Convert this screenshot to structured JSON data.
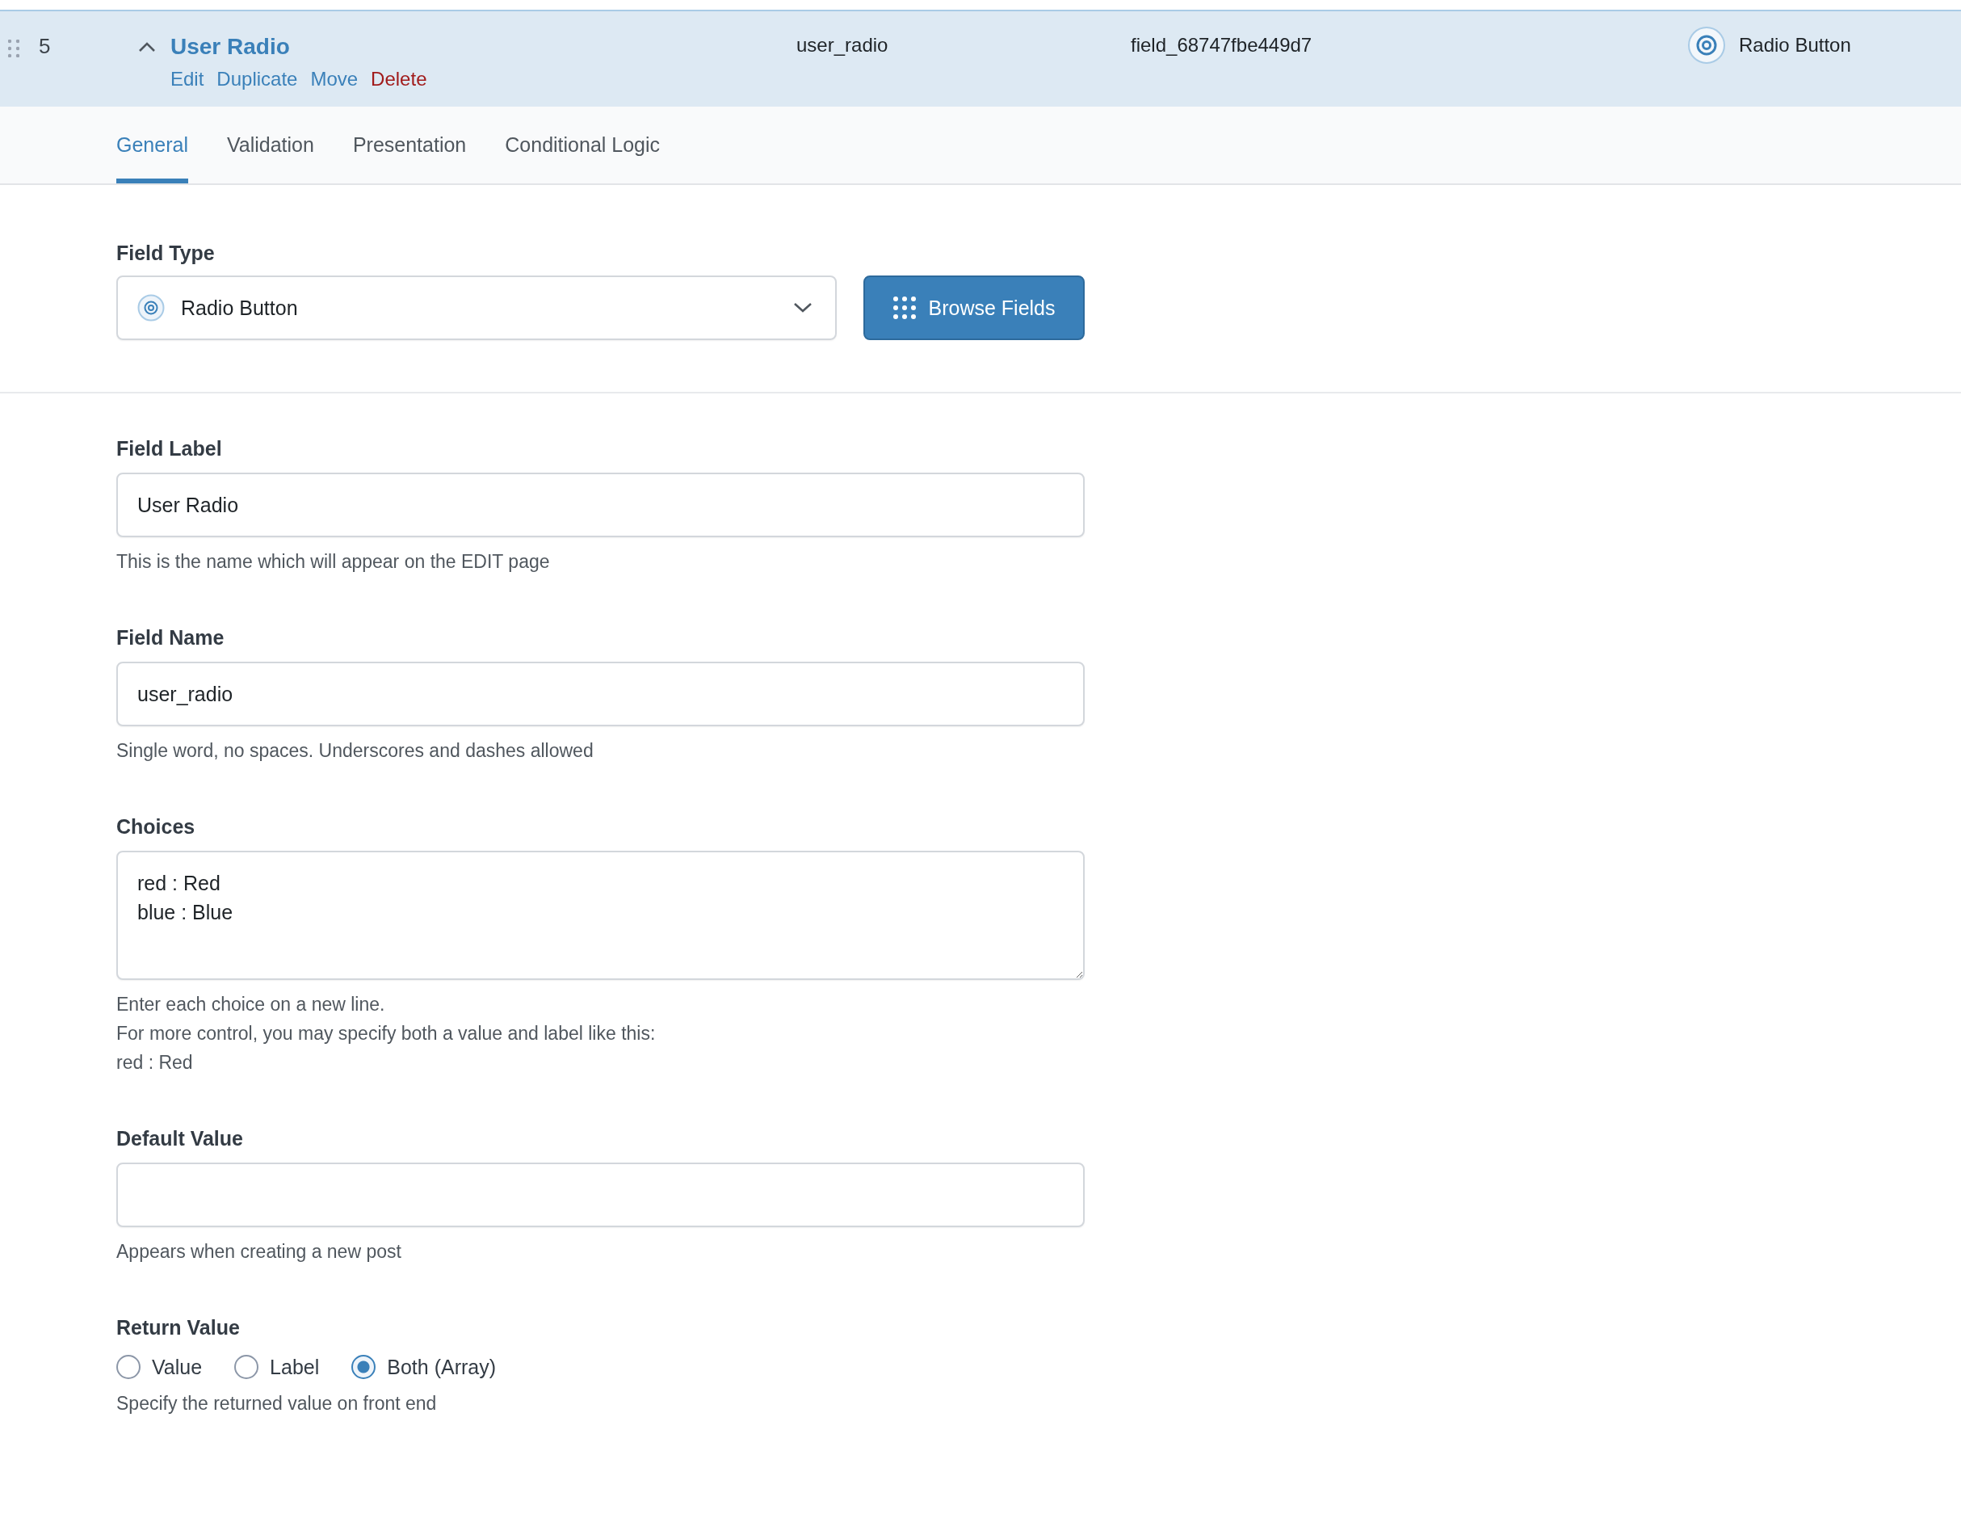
{
  "field_row": {
    "order": "5",
    "expanded": true,
    "label": "User Radio",
    "name": "user_radio",
    "key": "field_68747fbe449d7",
    "type": "Radio Button",
    "actions": [
      {
        "label": "Edit",
        "kind": "link"
      },
      {
        "label": "Duplicate",
        "kind": "link"
      },
      {
        "label": "Move",
        "kind": "link"
      },
      {
        "label": "Delete",
        "kind": "danger"
      }
    ]
  },
  "tabs": [
    {
      "label": "General",
      "selected": true
    },
    {
      "label": "Validation",
      "selected": false
    },
    {
      "label": "Presentation",
      "selected": false
    },
    {
      "label": "Conditional Logic",
      "selected": false
    }
  ],
  "field_type": {
    "label": "Field Type",
    "value": "Radio Button",
    "button": "Browse Fields"
  },
  "settings": [
    {
      "kind": "text",
      "label": "Field Label",
      "value": "User Radio",
      "help": [
        "This is the name which will appear on the EDIT page"
      ]
    },
    {
      "kind": "text",
      "label": "Field Name",
      "value": "user_radio",
      "help": [
        "Single word, no spaces. Underscores and dashes allowed"
      ]
    },
    {
      "kind": "textarea",
      "label": "Choices",
      "value": "red : Red\nblue : Blue",
      "help": [
        "Enter each choice on a new line.",
        "For more control, you may specify both a value and label like this:",
        "red : Red"
      ]
    },
    {
      "kind": "text",
      "label": "Default Value",
      "help": [
        "Appears when creating a new post"
      ]
    },
    {
      "kind": "radio",
      "label": "Return Value",
      "options": [
        {
          "label": "Value",
          "selected": false
        },
        {
          "label": "Label",
          "selected": false
        },
        {
          "label": "Both (Array)",
          "selected": true
        }
      ],
      "help": [
        "Specify the returned value on front end"
      ]
    }
  ]
}
